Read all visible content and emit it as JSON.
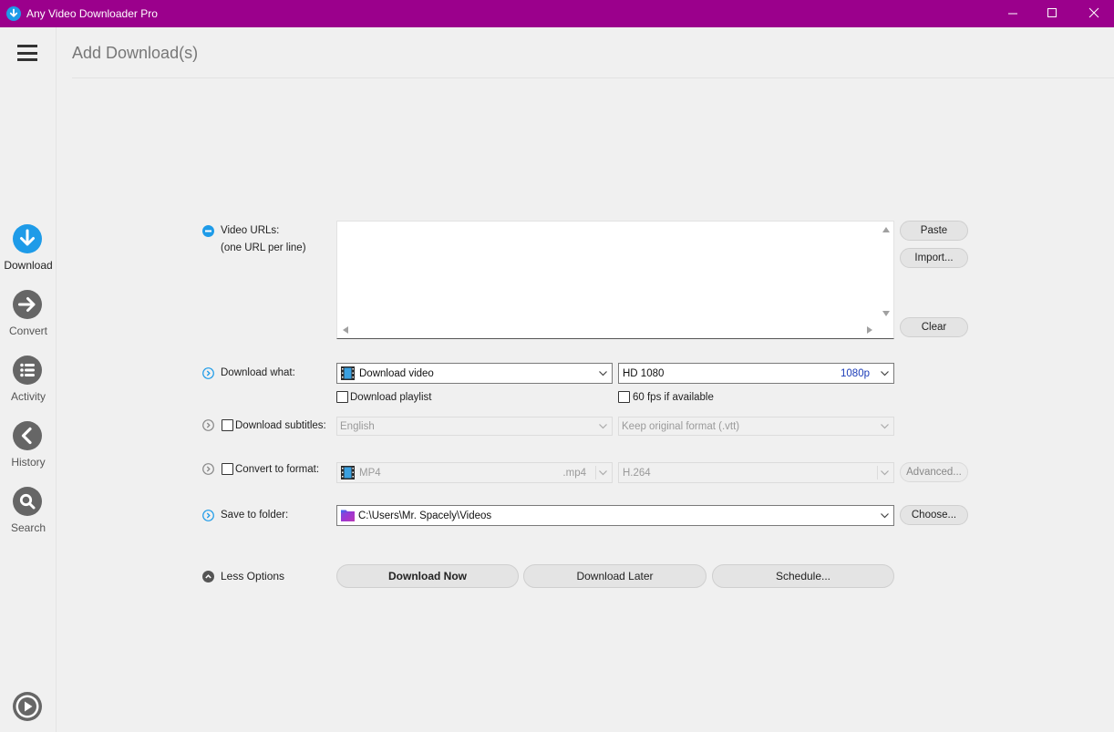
{
  "window": {
    "title": "Any Video Downloader Pro",
    "accent": "#9b008c"
  },
  "sidebar": {
    "items": [
      {
        "label": "Download",
        "icon": "download-icon",
        "active": true
      },
      {
        "label": "Convert",
        "icon": "arrow-right-icon"
      },
      {
        "label": "Activity",
        "icon": "list-icon"
      },
      {
        "label": "History",
        "icon": "arrow-left-icon"
      },
      {
        "label": "Search",
        "icon": "search-icon"
      }
    ],
    "bottom_icon": "play-icon"
  },
  "main": {
    "page_title": "Add Download(s)",
    "video_urls": {
      "label": "Video URLs:",
      "sublabel": "(one URL per line)",
      "value": "",
      "paste_label": "Paste",
      "import_label": "Import...",
      "clear_label": "Clear"
    },
    "download_what": {
      "label": "Download what:",
      "type_value": "Download video",
      "quality_value": "HD 1080",
      "quality_tag": "1080p",
      "playlist_label": "Download playlist",
      "playlist_checked": false,
      "fps_label": "60 fps if available",
      "fps_checked": false
    },
    "subtitles": {
      "label": "Download subtitles:",
      "checked": false,
      "language": "English",
      "format": "Keep original format (.vtt)"
    },
    "convert": {
      "label": "Convert to format:",
      "checked": false,
      "format": "MP4",
      "format_ext": ".mp4",
      "codec": "H.264",
      "advanced_label": "Advanced..."
    },
    "save": {
      "label": "Save to folder:",
      "path": "C:\\Users\\Mr. Spacely\\Videos",
      "choose_label": "Choose..."
    },
    "actions": {
      "less_options": "Less Options",
      "download_now": "Download Now",
      "download_later": "Download Later",
      "schedule": "Schedule..."
    }
  }
}
